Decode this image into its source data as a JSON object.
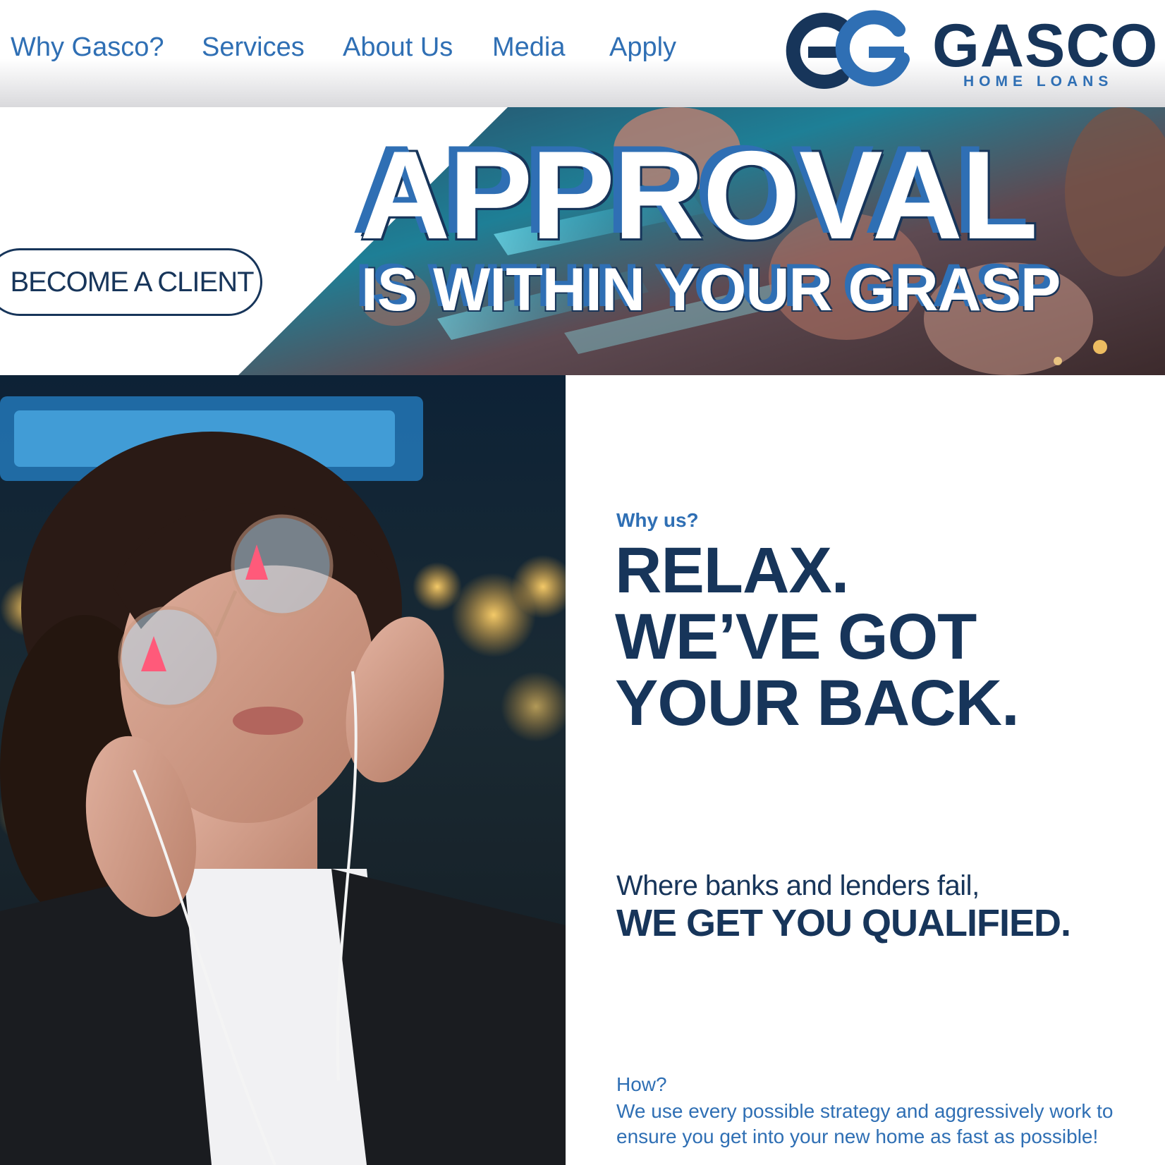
{
  "nav": {
    "items": [
      {
        "label": "Why Gasco?"
      },
      {
        "label": "Services"
      },
      {
        "label": "About Us"
      },
      {
        "label": "Media"
      },
      {
        "label": "Apply"
      }
    ]
  },
  "logo": {
    "name": "GASCO",
    "tagline": "HOME LOANS"
  },
  "hero": {
    "cta_label": "BECOME A CLIENT",
    "headline_main": "APPROVAL",
    "headline_sub": "IS WITHIN YOUR GRASP"
  },
  "why": {
    "eyebrow": "Why us?",
    "headline_lines": [
      "RELAX.",
      "WE’VE GOT",
      "YOUR BACK."
    ],
    "sub_plain": "Where banks and lenders fail,",
    "sub_bold": "WE GET YOU QUALIFIED.",
    "how_label": "How?",
    "how_text": "We use every possible strategy and aggressively work to ensure you get into your new home as fast as possible!"
  },
  "colors": {
    "navy": "#17355a",
    "brand_blue": "#2f6fb4",
    "white": "#ffffff"
  },
  "icons": {
    "logo_mark": "gasco-gg-monogram-icon"
  }
}
